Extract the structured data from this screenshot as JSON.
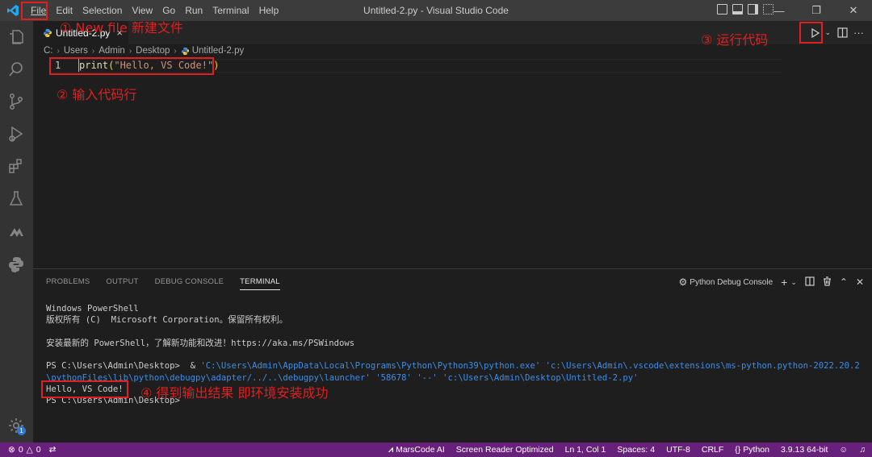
{
  "colors": {
    "accent_red": "#e02020",
    "status_bar": "#68217a",
    "titlebar": "#3c3c3c",
    "editor_bg": "#1e1e1e"
  },
  "menu": [
    "File",
    "Edit",
    "Selection",
    "View",
    "Go",
    "Run",
    "Terminal",
    "Help"
  ],
  "window_title": "Untitled-2.py - Visual Studio Code",
  "tab": {
    "label": "Untitled-2.py",
    "close": "×"
  },
  "breadcrumb": [
    "C:",
    "Users",
    "Admin",
    "Desktop",
    "Untitled-2.py"
  ],
  "editor": {
    "line_number": "1",
    "code_fn": "print",
    "code_open": "(",
    "code_str": "\"Hello, VS Code!\"",
    "code_close": ")"
  },
  "annotations": {
    "a1": "① New file 新建文件",
    "a2": "② 输入代码行",
    "a3": "③ 运行代码",
    "a4": "④ 得到输出结果 即环境安装成功"
  },
  "panel": {
    "tabs": [
      "PROBLEMS",
      "OUTPUT",
      "DEBUG CONSOLE",
      "TERMINAL"
    ],
    "debug_console_label": "Python Debug Console"
  },
  "terminal": {
    "l1": "Windows PowerShell",
    "l2": "版权所有 (C)  Microsoft Corporation。保留所有权利。",
    "l3": "安装最新的 PowerShell，了解新功能和改进！https://aka.ms/PSWindows",
    "l4_prompt": "PS C:\\Users\\Admin\\Desktop>  & ",
    "l4_cmd": "'C:\\Users\\Admin\\AppData\\Local\\Programs\\Python\\Python39\\python.exe' 'c:\\Users\\Admin\\.vscode\\extensions\\ms-python.python-2022.20.2",
    "l5": "\\pythonFiles\\lib\\python\\debugpy\\adapter/../..\\debugpy\\launcher' '58678' '--' 'c:\\Users\\Admin\\Desktop\\Untitled-2.py'",
    "l6": "Hello, VS Code!",
    "l7": "PS C:\\Users\\Admin\\Desktop>"
  },
  "statusbar": {
    "errors": "0",
    "warnings": "0",
    "marscode": "MarsCode AI",
    "screen_reader": "Screen Reader Optimized",
    "position": "Ln 1, Col 1",
    "spaces": "Spaces: 4",
    "encoding": "UTF-8",
    "eol": "CRLF",
    "language": "Python",
    "interpreter": "3.9.13 64-bit"
  }
}
